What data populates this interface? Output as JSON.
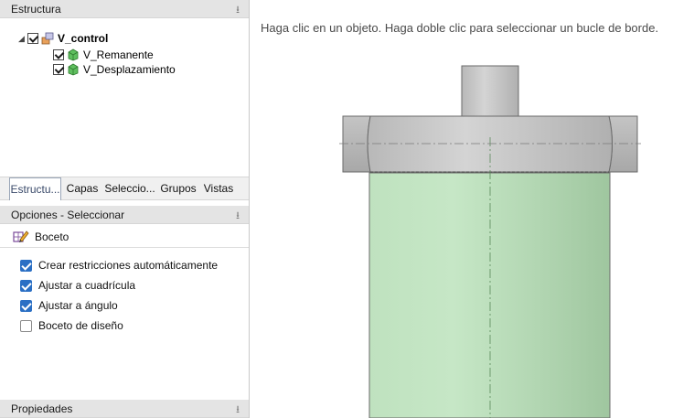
{
  "structure_panel": {
    "title": "Estructura",
    "pin": "⭳",
    "tree": {
      "root": {
        "label": "V_control",
        "expander": "◢",
        "checked": true,
        "icon": "assembly-icon"
      },
      "children": [
        {
          "label": "V_Remanente",
          "checked": true,
          "icon": "part-icon"
        },
        {
          "label": "V_Desplazamiento",
          "checked": true,
          "icon": "part-icon"
        }
      ]
    }
  },
  "tabs": [
    {
      "label": "Estructu...",
      "active": true
    },
    {
      "label": "Capas",
      "active": false
    },
    {
      "label": "Seleccio...",
      "active": false
    },
    {
      "label": "Grupos",
      "active": false
    },
    {
      "label": "Vistas",
      "active": false
    }
  ],
  "options_panel": {
    "title": "Opciones - Seleccionar",
    "pin": "⭳",
    "section": {
      "label": "Boceto",
      "icon": "sketch-pencil-icon"
    },
    "options": [
      {
        "label": "Crear restricciones automáticamente",
        "checked": true
      },
      {
        "label": "Ajustar a cuadrícula",
        "checked": true
      },
      {
        "label": "Ajustar a ángulo",
        "checked": true
      },
      {
        "label": "Boceto de diseño",
        "checked": false
      }
    ]
  },
  "properties_panel": {
    "title": "Propiedades",
    "pin": "⭳"
  },
  "viewport": {
    "hint": "Haga clic en un objeto. Haga doble clic para seleccionar un bucle de borde."
  },
  "colors": {
    "accent_checkbox": "#2a6fc4",
    "body_green": "#b9dcb9",
    "metal_gray": "#c8c8c8"
  }
}
